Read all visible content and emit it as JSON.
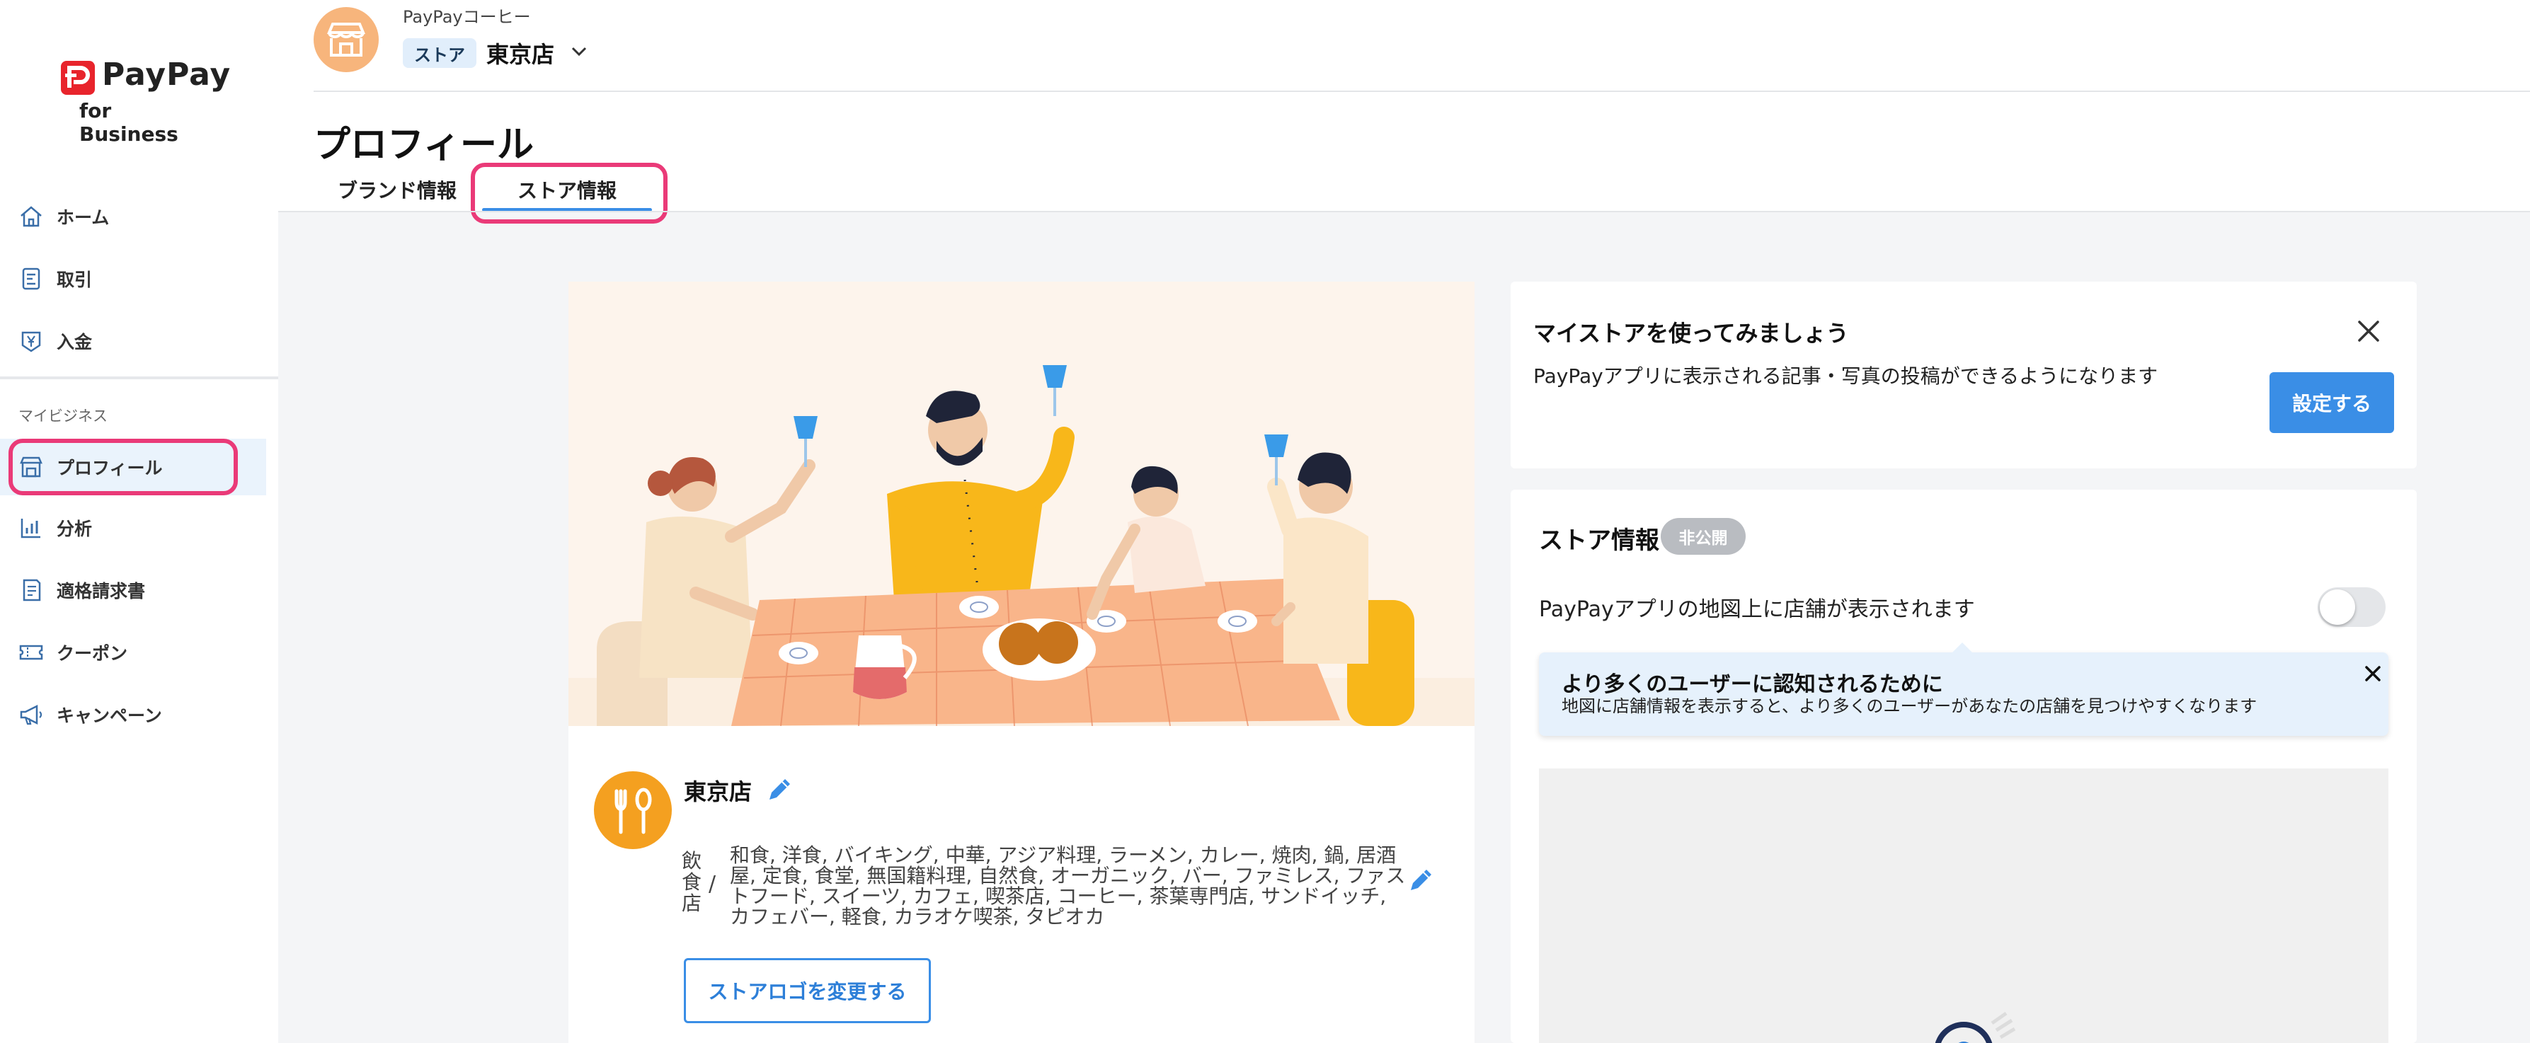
{
  "app": {
    "logo_text": "PayPay",
    "logo_sub": "for Business"
  },
  "sidebar": {
    "items": [
      {
        "label": "ホーム",
        "icon": "home-icon"
      },
      {
        "label": "取引",
        "icon": "receipt-icon"
      },
      {
        "label": "入金",
        "icon": "yen-deposit-icon"
      }
    ],
    "section_label": "マイビジネス",
    "section_items": [
      {
        "label": "プロフィール",
        "icon": "storefront-icon",
        "active": true
      },
      {
        "label": "分析",
        "icon": "bar-chart-icon"
      },
      {
        "label": "適格請求書",
        "icon": "invoice-icon"
      },
      {
        "label": "クーポン",
        "icon": "coupon-icon"
      },
      {
        "label": "キャンペーン",
        "icon": "megaphone-icon"
      }
    ]
  },
  "header": {
    "brand_name": "PayPayコーヒー",
    "store_chip": "ストア",
    "store_name": "東京店",
    "page_title": "プロフィール",
    "tabs": [
      {
        "label": "ブランド情報",
        "active": false
      },
      {
        "label": "ストア情報",
        "active": true
      }
    ]
  },
  "store_card": {
    "name": "東京店",
    "category_main": "飲食店",
    "category_separator": "/",
    "category_sub": "和食, 洋食, バイキング, 中華, アジア料理, ラーメン, カレー, 焼肉, 鍋, 居酒屋, 定食, 食堂, 無国籍料理, 自然食, オーガニック, バー, ファミレス, ファストフード, スイーツ, カフェ, 喫茶店, コーヒー, 茶葉専門店, サンドイッチ, カフェバー, 軽食, カラオケ喫茶, タピオカ",
    "change_logo_button": "ストアロゴを変更する"
  },
  "promo": {
    "title": "マイストアを使ってみましょう",
    "description": "PayPayアプリに表示される記事・写真の投稿ができるようになります",
    "button": "設定する"
  },
  "store_info": {
    "title": "ストア情報",
    "status_badge": "非公開",
    "map_toggle_label": "PayPayアプリの地図上に店舗が表示されます",
    "map_toggle_on": false,
    "tooltip_title": "より多くのユーザーに認知されるために",
    "tooltip_desc": "地図に店舗情報を表示すると、より多くのユーザーがあなたの店舗を見つけやすくなります"
  },
  "colors": {
    "accent": "#3a8ee6",
    "highlight": "#ea3a78",
    "brand_red": "#e8242c",
    "avatar_orange": "#f7b57c",
    "category_orange": "#f4a020"
  }
}
